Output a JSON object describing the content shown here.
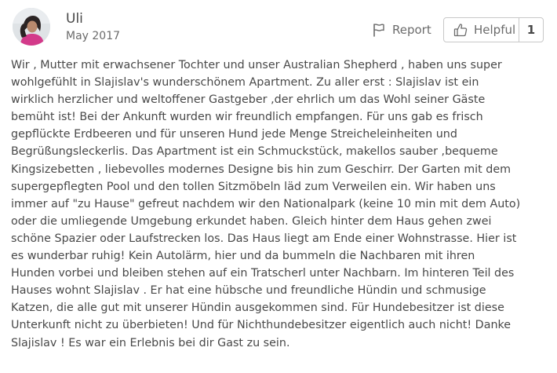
{
  "review": {
    "reviewer": {
      "name": "Uli",
      "date": "May 2017",
      "avatar_icon": "profile-photo"
    },
    "actions": {
      "report_label": "Report",
      "report_icon": "flag-icon",
      "helpful_label": "Helpful",
      "helpful_icon": "thumbs-up-icon",
      "helpful_count": "1"
    },
    "body_lines": [
      "Wir , Mutter mit erwachsener Tochter und unser Australian Shepherd , haben uns super",
      "wohlgefühlt in Slajislav's wunderschönem Apartment. Zu aller erst : Slajislav ist ein",
      "wirklich herzlicher und weltoffener Gastgeber ,der ehrlich um das Wohl seiner Gäste",
      "bemüht ist! Bei der Ankunft wurden wir freundlich empfangen. Für uns gab es frisch",
      "gepflückte Erdbeeren und für unseren Hund jede Menge Streicheleinheiten und",
      "Begrüßungsleckerlis. Das Apartment ist ein Schmuckstück, makellos sauber ,bequeme",
      "Kingsizebetten , liebevolles modernes Designe bis hin zum Geschirr. Der Garten mit dem",
      "supergepflegten Pool und den tollen Sitzmöbeln läd zum Verweilen ein. Wir haben uns",
      "immer auf \"zu Hause\" gefreut nachdem wir den Nationalpark (keine 10 min mit dem Auto)",
      "oder die umliegende Umgebung erkundet haben. Gleich hinter dem Haus gehen zwei",
      "schöne Spazier oder Laufstrecken los. Das Haus liegt am Ende einer Wohnstrasse. Hier ist",
      "es wunderbar ruhig! Kein Autolärm, hier und da bummeln die Nachbaren mit ihren",
      "Hunden vorbei und bleiben stehen auf ein Tratscherl unter Nachbarn. Im hinteren Teil des",
      "Hauses wohnt Slajislav . Er hat eine hübsche und freundliche Hündin und schmusige",
      "Katzen, die alle gut mit unserer Hündin ausgekommen sind. Für Hundebesitzer ist diese",
      "Unterkunft nicht zu überbieten! Und für Nichthundebesitzer eigentlich auch nicht! Danke",
      "Slajislav ! Es war ein Erlebnis bei dir Gast zu sein."
    ]
  }
}
